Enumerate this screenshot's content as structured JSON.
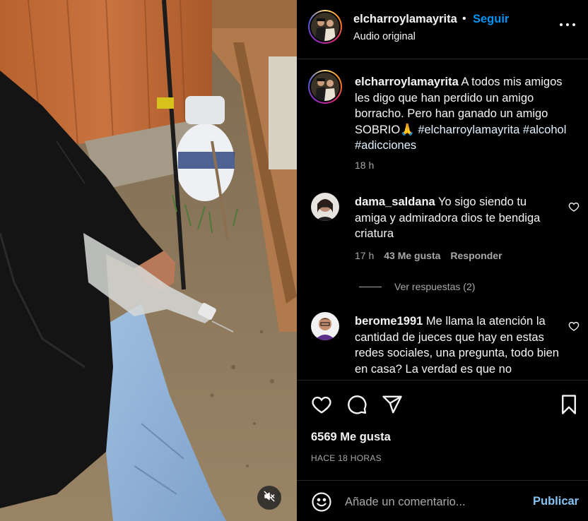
{
  "post": {
    "username": "elcharroylamayrita",
    "separator": "•",
    "follow_label": "Seguir",
    "audio_label": "Audio original",
    "more_icon": "more-horizontal-icon"
  },
  "caption": {
    "username": "elcharroylamayrita",
    "text": "A todos mis amigos les digo que han perdido un amigo borracho. Pero han ganado un amigo SOBRIO",
    "emoji": "🙏",
    "hashtags": [
      "#elcharroylamayrita",
      "#alcohol",
      "#adicciones"
    ],
    "time": "18 h"
  },
  "comments": [
    {
      "username": "dama_saldana",
      "text": "Yo sigo siendo tu amiga y admiradora dios te bendiga criatura",
      "time": "17 h",
      "likes": "43 Me gusta",
      "reply_label": "Responder",
      "view_replies": "Ver respuestas (2)"
    },
    {
      "username": "berome1991",
      "text": "Me llama la atención la cantidad de jueces que hay en estas redes sociales, una pregunta, todo bien en casa? La verdad es que no"
    }
  ],
  "actions": {
    "like_icon": "heart-icon",
    "comment_icon": "comment-icon",
    "share_icon": "share-icon",
    "save_icon": "bookmark-icon",
    "likes_text": "6569 Me gusta",
    "post_time": "HACE 18 HORAS"
  },
  "comment_bar": {
    "placeholder": "Añade un comentario...",
    "publish_label": "Publicar",
    "emoji_icon": "emoji-icon"
  },
  "media": {
    "mute_icon": "volume-muted-icon"
  },
  "colors": {
    "follow": "#0095f6",
    "publish": "#85c4f5",
    "background": "#000000",
    "secondary_text": "#a8a8a8"
  }
}
